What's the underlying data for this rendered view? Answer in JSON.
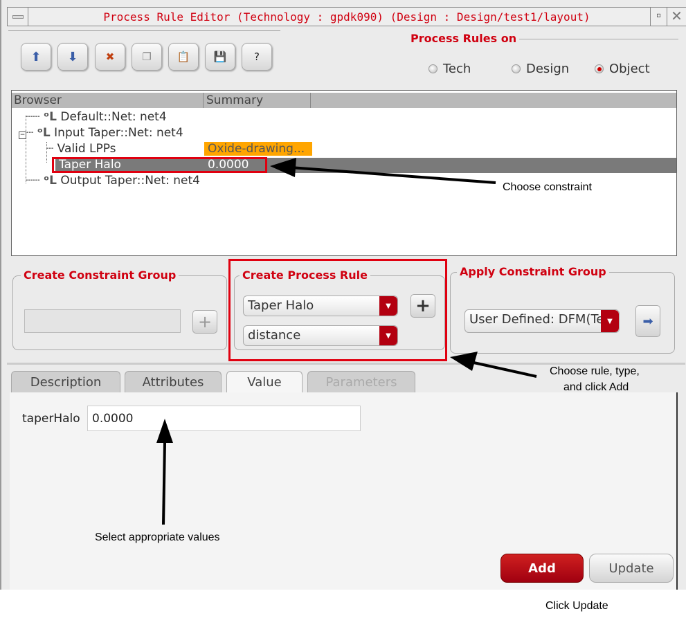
{
  "window": {
    "title": "Process Rule Editor (Technology : gpdk090) (Design : Design/test1/layout)"
  },
  "toolbar": {
    "buttons": [
      {
        "icon": "move-up-icon"
      },
      {
        "icon": "move-down-icon"
      },
      {
        "icon": "delete-icon"
      },
      {
        "icon": "copy-icon"
      },
      {
        "icon": "paste-icon"
      },
      {
        "icon": "save-icon"
      },
      {
        "icon": "help-icon",
        "label": "?"
      }
    ]
  },
  "process_rules_on": {
    "label": "Process Rules on",
    "options": [
      "Tech",
      "Design",
      "Object"
    ],
    "selected": "Object"
  },
  "browser": {
    "columns": [
      "Browser",
      "Summary"
    ],
    "rows": [
      {
        "label": "Default::Net: net4",
        "summary": ""
      },
      {
        "label": "Input Taper::Net: net4",
        "summary": ""
      },
      {
        "label": "Valid LPPs",
        "summary": "Oxide-drawing..."
      },
      {
        "label": "Taper Halo",
        "summary": "0.0000"
      },
      {
        "label": "Output Taper::Net: net4",
        "summary": ""
      }
    ]
  },
  "create_constraint_group": {
    "title": "Create Constraint Group",
    "value": ""
  },
  "create_process_rule": {
    "title": "Create Process Rule",
    "rule": "Taper Halo",
    "type": "distance"
  },
  "apply_constraint_group": {
    "title": "Apply Constraint Group",
    "value": "User Defined: DFM(Te"
  },
  "tabs": [
    "Description",
    "Attributes",
    "Value",
    "Parameters"
  ],
  "value_panel": {
    "label": "taperHalo",
    "value": "0.0000"
  },
  "buttons": {
    "add": "Add",
    "update": "Update"
  },
  "annotations": {
    "choose_constraint": "Choose constraint",
    "choose_rule": "Choose rule, type,",
    "choose_rule2": "and click Add",
    "select_values": "Select appropriate values",
    "click_update": "Click Update"
  },
  "colors": {
    "accent": "#d00010",
    "selected_row": "#7a7a7a",
    "summary_highlight": "#ffa500"
  }
}
